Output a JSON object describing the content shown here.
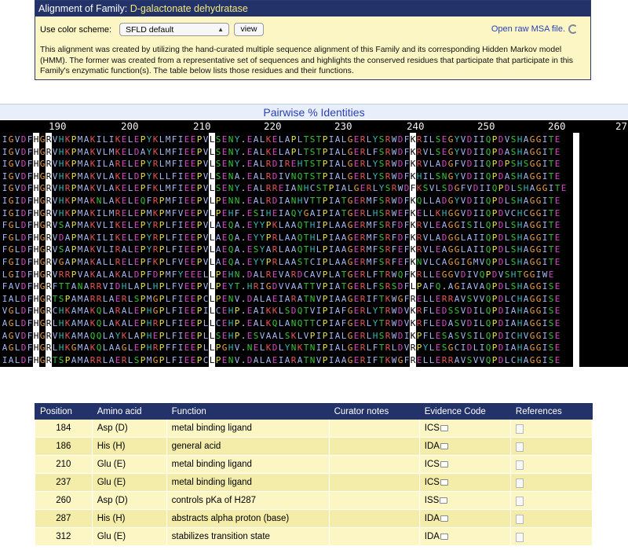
{
  "family": {
    "header_prefix": "Alignment of Family:",
    "name": "D-galactonate dehydratase",
    "color_scheme_label": "Use color scheme:",
    "color_scheme_value": "SFLD default",
    "view_button": "view",
    "msa_link": "Open raw MSA file.",
    "description": "This alignment was created by utilizing the hand-curated multiple sequence alignment of this Family and its corresponding Hidden Markov model (HMM). The former was created from a representative set of sequences and highlights the conserved residues that participate that participate in this Family's enzymatic function(s). The table below lists those residues and their functions."
  },
  "alignment": {
    "title": "Pairwise % Identities",
    "ruler": [
      "190",
      "200",
      "210",
      "220",
      "230",
      "240",
      "250",
      "260",
      "27"
    ],
    "highlight_columns": [
      5,
      7,
      33,
      65,
      91
    ],
    "sequences": [
      "IGVDFHGRVHKPMAKILIKELEPYKLMFIEEPVLSENY.EALKELAPLTSTPIALGERLYSRWDFKRILSEGYVDIIQPDVSHAGGITE",
      "IGVDFHGRVHKPMAKVLMKELDAYKLMFIEEPVLSENY.EALKELAPLTSTPIALGERLFSRWDFKRVLSEGYVDIIQPDASHAGGITE",
      "IGVDFHGRVHKPMAKILARELEPYRLMFIEEPVLSENY.EALRDIREHTSTPIALGERLYSRWDFKRVLADGFVDIIQPDPSHSGGITE",
      "IGVDFHGRVHKPMAKVLAKELDPYKLLFIEEPVLSENA.EALRDIVNQTSTPIALGERLYSRWDFKHILSNGYVDIIQPDASHAGGITE",
      "IGVDFHGRVHRPMAKVLAKELEPFKLMFIEEPVLSENY.EALRREIANHCSTPIALGERLYSRWDFKSVLSDGFVDIIQPDLSHAGGITE",
      "IGIDFHGRVHKPMAKNLAKELEQFRPMFIEEPVLPENN.EALRDIANHVTTPIATGERMFSRWDFKQLLADGYVDIIQPDLSHAGGITE",
      "IGIDFHGRVHKPMAKILMRELEPMKPMFVEEPVLPEHF.ESIHEIAQYGAIPIATGERLHSRWEFKELLKHGGVDIIQPDVCHCGGITE",
      "FGLDFHGRVSAPMAKVLIKELEPYRPLFIEEPVLAEQA.EYYPKLAAQTHIPLAAGERMFSRFDFKRVLEAGGISILQPDLSHAGGITE",
      "FGLDFHGRVDAPMAKILIKELEPYRPLFIEEPVLAEQA.EYYPRLAAQTHLPIAAGERMFSRFDFKRVLADGGLAIIQPDLSHAGGITE",
      "FGLDFHGRVSAPMAKVLIRALEPYRPLFIEEPVLAEQA.ESYARLAAQTHLPIAAGERMFSRFEFKRVLEAGGLAIIQPDLSHAGGITE",
      "FGIDFHGRVGAPMAKALLRELEPFKPLFVEEPVLAEQA.EYYPRLAASTCIPLAAGERMFSRFEFKNVLCAGGIGMVQPDLSHAGGITE",
      "LGIDFHGRVRRPVAKALAKALDPFDPMFYEEELLPEHN.DALREVARDCAVPLATGERLFTRWQFKRLLEGGVDIVQPDVSHTGGIWE",
      "FAVDFHGRFTTANARRVIDHLAPLHPLFVEEPVLPEYT.HRIGDVVAATTVPIATGERLFSRSDFLPAFQ.AGIAVAQPDLSHAGGISE",
      "IALDFHGRTSPAMARRLAERLSPMGPLFIEEPCLPENV.DALAEIARATNVPIAAGERIFTKWGFRELLERRAVSVVQPDLCHAGGISE",
      "VGLDFHGRCHKAMAKQLARALEPHGPLFIEEPILCEHP.EAIKKLSDQTVIPIAFGERLYTRWDVKRFLEDSSVDILQPDIAHAGGISE",
      "AGLDFHGRLHKAMAKQLAKALEPHRPLFIEEPLLCEHP.EALKQLANQTTCPIAFGERLYTRWDVKRFLEDASVDILQPDIAHAGGISE",
      "AGVDFHGRVHKAMAQQLAYKLAPHEPLFIEEPLLSEHP.ESVAALSKLVPIPIALGERLHSRWDIKPFLESASVSILQPDICHVGGISE",
      "AGLDFHGRLHKGMAKQLAAGLEPHRPFFIEEPLLPGHV.NELKDLYNKTNIPIALGERLFTRLDVRPYLESGCIDLIQPDIAHAGGISE",
      "IALDFHGRTSPAMARRLAERLSPMGPLFIEEPCLPENV.DALAEIARATNVPIAAGERIFTKWGFRELLERRAVSVVQPDLCHAGGISE"
    ]
  },
  "table": {
    "headers": [
      "Position",
      "Amino acid",
      "Function",
      "Curator notes",
      "Evidence Code",
      "References"
    ],
    "rows": [
      {
        "position": "184",
        "amino_acid": "Asp (D)",
        "function": "metal binding ligand",
        "notes": "",
        "evidence": "ICS"
      },
      {
        "position": "186",
        "amino_acid": "His (H)",
        "function": "general acid",
        "notes": "",
        "evidence": "IDA"
      },
      {
        "position": "210",
        "amino_acid": "Glu (E)",
        "function": "metal binding ligand",
        "notes": "",
        "evidence": "ICS"
      },
      {
        "position": "237",
        "amino_acid": "Glu (E)",
        "function": "metal binding ligand",
        "notes": "",
        "evidence": "ICS"
      },
      {
        "position": "260",
        "amino_acid": "Asp (D)",
        "function": "controls pKa of H287",
        "notes": "",
        "evidence": "ISS"
      },
      {
        "position": "287",
        "amino_acid": "His (H)",
        "function": "abstracts alpha proton (base)",
        "notes": "",
        "evidence": "IDA"
      },
      {
        "position": "312",
        "amino_acid": "Glu (E)",
        "function": "stabilizes transition state",
        "notes": "",
        "evidence": "IDA"
      }
    ]
  }
}
